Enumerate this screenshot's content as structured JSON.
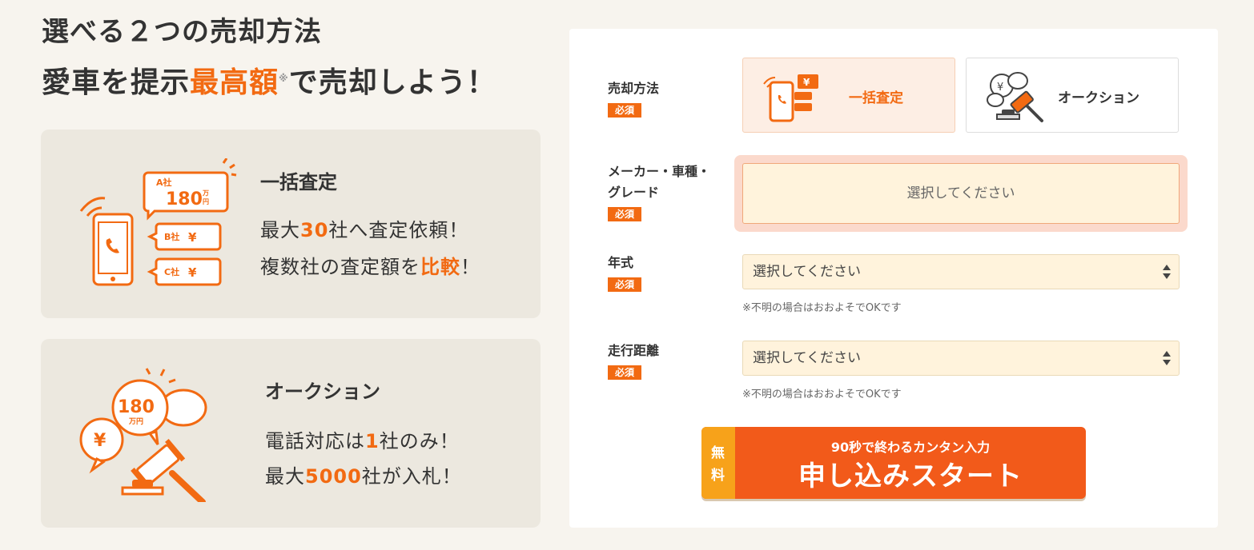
{
  "headline": {
    "line1": "選べる２つの売却方法",
    "line2_pre": "愛車を提示",
    "line2_accent": "最高額",
    "line2_mark": "※",
    "line2_post": "で売却しよう！"
  },
  "cards": [
    {
      "title": "一括査定",
      "line1_pre": "最大",
      "line1_accent": "30",
      "line1_post": "社へ査定依頼！",
      "line2_pre": "複数社の査定額を",
      "line2_accent": "比較",
      "line2_post": "！",
      "icon": {
        "bubble_a_label": "A社",
        "bubble_a_value": "180",
        "bubble_a_unit_top": "万",
        "bubble_a_unit_bottom": "円",
        "bubble_b_label": "B社",
        "bubble_c_label": "C社",
        "yen": "¥"
      }
    },
    {
      "title": "オークション",
      "line1_pre": "電話対応は",
      "line1_accent": "1",
      "line1_post": "社のみ！",
      "line2_pre": "最大",
      "line2_accent": "5000",
      "line2_post": "社が入札！",
      "icon": {
        "value": "180",
        "unit": "万円",
        "yen": "¥"
      }
    }
  ],
  "form": {
    "method_label": "売却方法",
    "required": "必須",
    "options": [
      {
        "label": "一括査定",
        "active": true,
        "icon": "phone-bubbles-icon"
      },
      {
        "label": "オークション",
        "active": false,
        "icon": "gavel-bubbles-icon"
      }
    ],
    "maker_label_1": "メーカー・車種・",
    "maker_label_2": "グレード",
    "maker_placeholder": "選択してください",
    "year_label": "年式",
    "year_value": "選択してください",
    "year_note": "※不明の場合はおおよそでOKです",
    "mileage_label": "走行距離",
    "mileage_value": "選択してください",
    "mileage_note": "※不明の場合はおおよそでOKです"
  },
  "cta": {
    "free_1": "無",
    "free_2": "料",
    "sub": "90秒で終わるカンタン入力",
    "main": "申し込みスタート"
  },
  "colors": {
    "accent": "#f26a12",
    "cta": "#f25a1a",
    "badge": "#f26a12",
    "free": "#f7a21a",
    "field_bg": "#fff3dc"
  }
}
